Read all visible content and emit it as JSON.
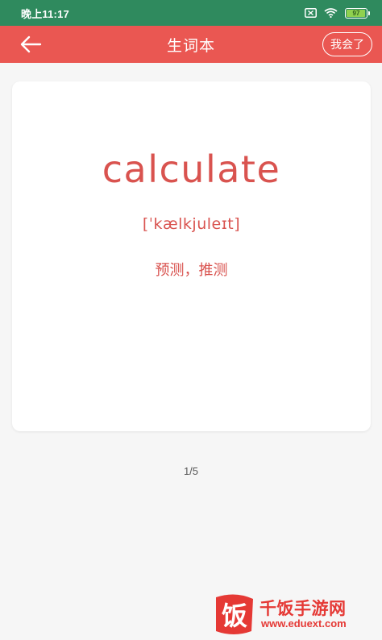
{
  "status_bar": {
    "time": "晚上11:17",
    "battery_level": "97",
    "battery_fraction": 0.97
  },
  "app_bar": {
    "title": "生词本",
    "back_icon": "arrow-left-icon",
    "known_button_label": "我会了"
  },
  "card": {
    "word": "calculate",
    "phonetic": "[ˈkælkjuleɪt]",
    "meaning": "预测，推测"
  },
  "pager": {
    "current": 1,
    "total": 5,
    "label": "1/5"
  },
  "watermark": {
    "logo": "饭",
    "name": "千饭手游网",
    "url": "www.eduext.com"
  },
  "colors": {
    "status_bar": "#2f8a5e",
    "app_bar": "#ea5752",
    "accent_text": "#d9534f",
    "background": "#f6f6f6"
  }
}
